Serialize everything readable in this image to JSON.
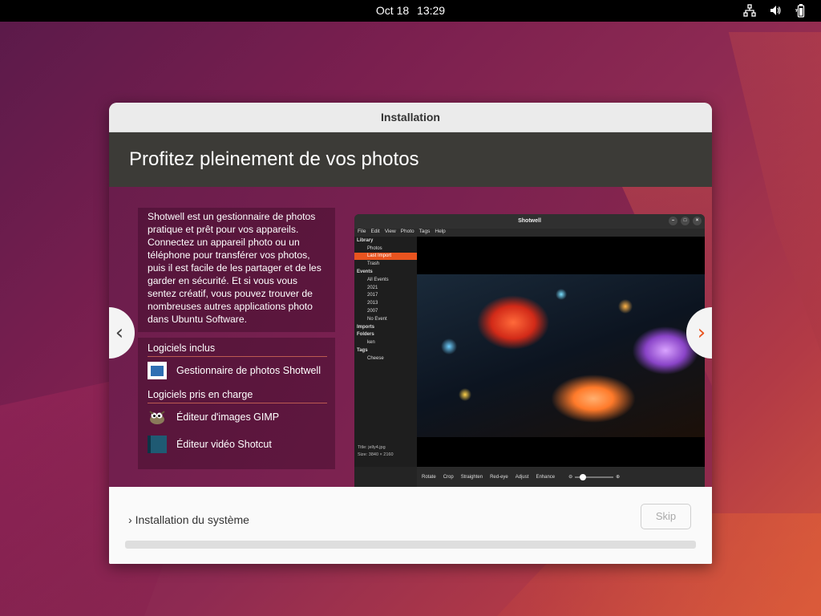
{
  "topbar": {
    "date": "Oct 18",
    "time": "13:29",
    "icons": [
      "network-icon",
      "volume-icon",
      "battery-icon"
    ]
  },
  "window": {
    "title": "Installation",
    "header_title": "Profitez pleinement de vos photos",
    "description": "Shotwell est un gestionnaire de photos pratique et prêt pour vos appareils. Connectez un appareil photo ou un téléphone pour transférer vos photos, puis il est facile de les partager et de les garder en sécurité. Et si vous vous sentez créatif, vous pouvez trouver de nombreuses autres applications photo dans Ubuntu Software.",
    "included_heading": "Logiciels inclus",
    "included_apps": [
      {
        "label": "Gestionnaire de photos Shotwell",
        "icon": "shotwell-icon"
      }
    ],
    "supported_heading": "Logiciels pris en charge",
    "supported_apps": [
      {
        "label": "Éditeur d'images GIMP",
        "icon": "gimp-icon"
      },
      {
        "label": "Éditeur vidéo Shotcut",
        "icon": "shotcut-icon"
      }
    ],
    "prev_arrow": "‹",
    "next_arrow": "›",
    "footer": {
      "install_label": "Installation du système",
      "expander": "›",
      "skip_label": "Skip",
      "progress_fraction": 0
    }
  },
  "shotwell": {
    "title": "Shotwell",
    "menu": [
      "File",
      "Edit",
      "View",
      "Photo",
      "Tags",
      "Help"
    ],
    "sidebar": [
      {
        "label": "Library",
        "type": "h"
      },
      {
        "label": "Photos",
        "type": "ind"
      },
      {
        "label": "Last Import",
        "type": "ind",
        "selected": true
      },
      {
        "label": "Trash",
        "type": "ind"
      },
      {
        "label": "Events",
        "type": "h"
      },
      {
        "label": "All Events",
        "type": "ind"
      },
      {
        "label": "2021",
        "type": "ind"
      },
      {
        "label": "2017",
        "type": "ind"
      },
      {
        "label": "2013",
        "type": "ind"
      },
      {
        "label": "2007",
        "type": "ind"
      },
      {
        "label": "No Event",
        "type": "ind"
      },
      {
        "label": "Imports",
        "type": "h"
      },
      {
        "label": "Folders",
        "type": "h"
      },
      {
        "label": "ken",
        "type": "ind"
      },
      {
        "label": "Tags",
        "type": "h"
      },
      {
        "label": "Cheese",
        "type": "ind"
      }
    ],
    "meta": {
      "title_key": "Title:",
      "title_val": "jelly4.jpg",
      "size_key": "Size:",
      "size_val": "3840 × 2160"
    },
    "tools": [
      "Rotate",
      "Crop",
      "Straighten",
      "Red-eye",
      "Adjust",
      "Enhance"
    ]
  },
  "colors": {
    "accent": "#e9541f",
    "header_bg": "#3c3b37"
  }
}
